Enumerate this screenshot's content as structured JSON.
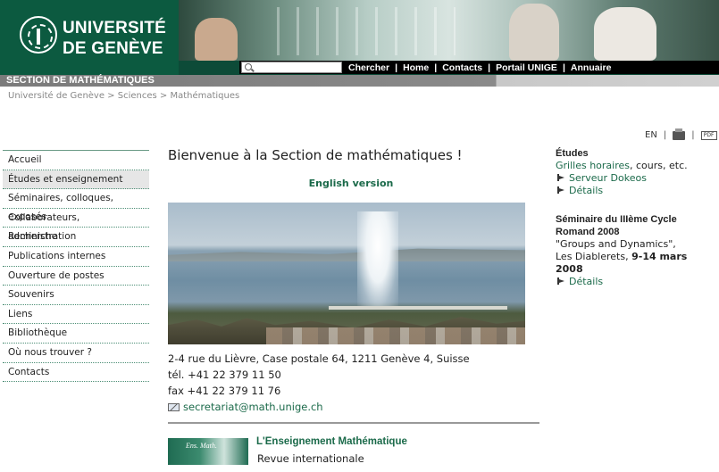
{
  "header": {
    "logo_line1": "UNIVERSITÉ",
    "logo_line2": "DE GENÈVE",
    "top_links": [
      "Chercher",
      "Home",
      "Contacts",
      "Portail UNIGE",
      "Annuaire"
    ],
    "separator": "|",
    "section_title": "SECTION DE MATHÉMATIQUES"
  },
  "breadcrumb": "Université de Genève > Sciences > Mathématiques",
  "tools": {
    "lang": "EN",
    "separator": "|",
    "pdf_label": "PDF"
  },
  "sidebar": {
    "items": [
      {
        "label": "Accueil",
        "active": false
      },
      {
        "label": "Études et enseignement",
        "active": true
      },
      {
        "label": "Séminaires, colloques, exposés",
        "active": false
      },
      {
        "label": "Collaborateurs, administration",
        "active": false
      },
      {
        "label": "Recherche",
        "active": false
      },
      {
        "label": "Publications internes",
        "active": false
      },
      {
        "label": "Ouverture de postes",
        "active": false
      },
      {
        "label": "Souvenirs",
        "active": false
      },
      {
        "label": "Liens",
        "active": false
      },
      {
        "label": "Bibliothèque",
        "active": false
      },
      {
        "label": "Où nous trouver ?",
        "active": false
      },
      {
        "label": "Contacts",
        "active": false
      }
    ]
  },
  "main": {
    "title": "Bienvenue à la Section de mathématiques !",
    "english_link": "English version",
    "address": {
      "line1": "2-4 rue du Lièvre, Case postale 64, 1211 Genève 4, Suisse",
      "phone": "tél. +41 22 379 11 50",
      "fax": "fax +41 22 379 11 76",
      "email": "secretariat@math.unige.ch"
    },
    "journal": {
      "logo_text": "Ens. Math.",
      "title": "L'Enseignement Mathématique",
      "subtitle": "Revue internationale"
    }
  },
  "right": {
    "etudes": {
      "heading": "Études",
      "link_text": "Grilles horaires",
      "after_link": ", cours, etc.",
      "links": [
        "Serveur Dokeos",
        "Détails"
      ]
    },
    "seminaire": {
      "heading_line1": "Séminaire du IIIème Cycle",
      "heading_line2": "Romand 2008",
      "topic": "\"Groups and Dynamics\",",
      "place": "Les Diablerets, ",
      "dates": "9-14 mars 2008",
      "link": "Détails"
    }
  },
  "colors": {
    "brand_green": "#0c5a40",
    "link_green": "#1b6a4a",
    "section_grey": "#7b7b7b"
  }
}
